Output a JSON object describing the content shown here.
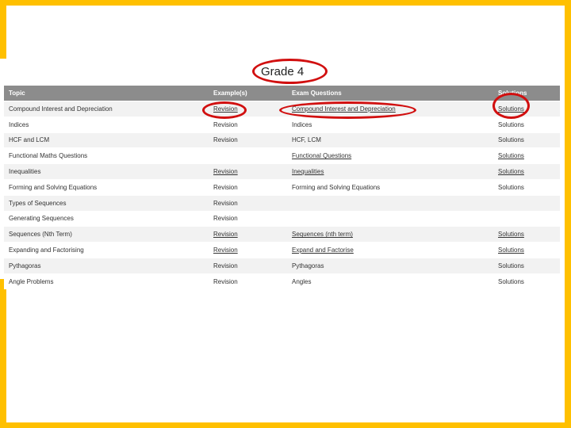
{
  "title": "Grade 4",
  "table": {
    "headers": [
      "Topic",
      "Example(s)",
      "Exam Questions",
      "Solutions"
    ],
    "rows": [
      {
        "topic": "Compound Interest and Depreciation",
        "example": "Revision",
        "exam": "Compound Interest and Depreciation",
        "solutions": "Solutions",
        "links": [
          true,
          true,
          true
        ]
      },
      {
        "topic": "Indices",
        "example": "Revision",
        "exam": "Indices",
        "solutions": "Solutions",
        "links": [
          false,
          false,
          false
        ]
      },
      {
        "topic": "HCF and LCM",
        "example": "Revision",
        "exam": "HCF, LCM",
        "solutions": "Solutions",
        "links": [
          false,
          false,
          false
        ]
      },
      {
        "topic": "Functional Maths Questions",
        "example": "",
        "exam": "Functional Questions",
        "solutions": "Solutions",
        "links": [
          false,
          true,
          true
        ]
      },
      {
        "topic": "Inequalities",
        "example": "Revision",
        "exam": "Inequalities",
        "solutions": "Solutions",
        "links": [
          true,
          true,
          true
        ]
      },
      {
        "topic": "Forming and Solving Equations",
        "example": "Revision",
        "exam": "Forming and Solving Equations",
        "solutions": "Solutions",
        "links": [
          false,
          false,
          false
        ]
      },
      {
        "topic": "Types of Sequences",
        "example": "Revision",
        "exam": "",
        "solutions": "",
        "links": [
          false,
          false,
          false
        ]
      },
      {
        "topic": "Generating Sequences",
        "example": "Revision",
        "exam": "",
        "solutions": "",
        "links": [
          false,
          false,
          false
        ]
      },
      {
        "topic": "Sequences (Nth Term)",
        "example": "Revision",
        "exam": "Sequences (nth term)",
        "solutions": "Solutions",
        "links": [
          true,
          true,
          true
        ]
      },
      {
        "topic": "Expanding and Factorising",
        "example": "Revision",
        "exam": "Expand and Factorise",
        "solutions": "Solutions",
        "links": [
          true,
          true,
          true
        ]
      },
      {
        "topic": "Pythagoras",
        "example": "Revision",
        "exam": "Pythagoras",
        "solutions": "Solutions",
        "links": [
          false,
          false,
          false
        ]
      },
      {
        "topic": "Angle Problems",
        "example": "Revision",
        "exam": "Angles",
        "solutions": "Solutions",
        "links": [
          false,
          false,
          false
        ]
      }
    ]
  },
  "colors": {
    "frame": "#ffc000",
    "header": "#8c8c8c",
    "annotation": "#d10f0f"
  }
}
